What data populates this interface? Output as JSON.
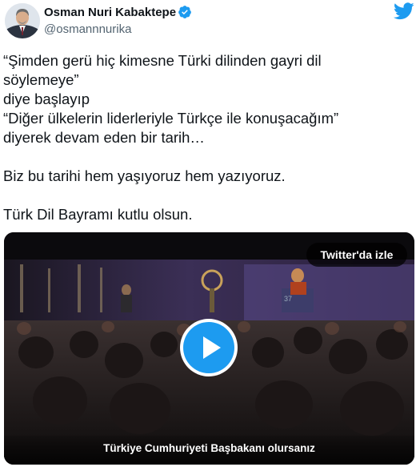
{
  "author": {
    "name": "Osman Nuri Kabaktepe",
    "handle": "@osmannnurika",
    "verified": true,
    "avatar_icon": "avatar"
  },
  "brand": {
    "icon": "twitter-bird-icon",
    "color": "#1d9bf0"
  },
  "tweet": {
    "paragraphs": [
      [
        "“Şimden gerü hiç kimesne Türki dilinden gayri dil",
        "söylemeye”",
        "diye başlayıp",
        "“Diğer ülkelerin liderleriyle Türkçe ile konuşacağım”",
        "diyerek devam eden bir tarih…"
      ],
      [
        "Biz bu tarihi hem yaşıyoruz hem yazıyoruz."
      ],
      [
        "Türk Dil Bayramı kutlu olsun."
      ]
    ]
  },
  "video": {
    "watch_on_twitter_label": "Twitter'da izle",
    "caption": "Türkiye Cumhuriyeti Başbakanı olursanız",
    "play_icon": "play-icon",
    "accent": "#1d9bf0"
  }
}
